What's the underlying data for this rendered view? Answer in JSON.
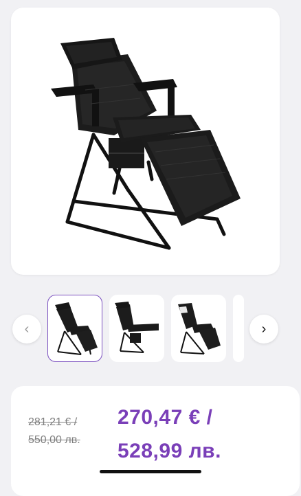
{
  "gallery": {
    "main_image": "black-cosmetic-chair",
    "prev_icon": "chevron-left-icon",
    "next_icon": "chevron-right-icon",
    "prev_glyph": "‹",
    "next_glyph": "›",
    "thumbnails": [
      {
        "image": "chair-angle-view",
        "selected": true
      },
      {
        "image": "chair-side-view",
        "selected": false
      },
      {
        "image": "chair-reclined-view",
        "selected": false
      },
      {
        "image": "chair-partial-view",
        "selected": false
      }
    ]
  },
  "pricing": {
    "old_price_line1": "281,21 € /",
    "old_price_line2": "550,00 лв.",
    "new_price_line1": "270,47 € /",
    "new_price_line2": "528,99 лв."
  },
  "colors": {
    "accent": "#7a3fb8",
    "selected_border": "#7a4fbf",
    "background": "#f1f1f4"
  }
}
